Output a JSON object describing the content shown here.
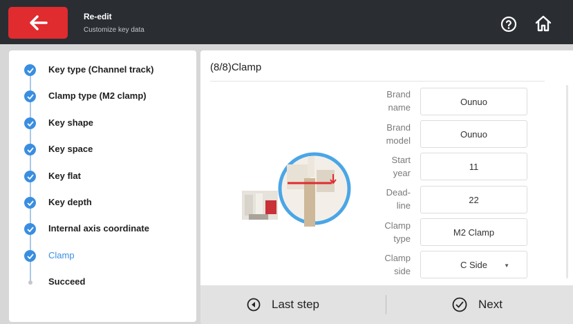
{
  "header": {
    "title": "Re-edit",
    "subtitle": "Customize key data",
    "back_icon": "arrow-left-icon",
    "help_icon": "help-circle-icon",
    "home_icon": "home-icon",
    "back_color": "#e02b2f"
  },
  "steps": [
    {
      "label": "Key type (Channel track)",
      "status": "done"
    },
    {
      "label": "Clamp type (M2 clamp)",
      "status": "done"
    },
    {
      "label": "Key shape",
      "status": "done"
    },
    {
      "label": "Key space",
      "status": "done"
    },
    {
      "label": "Key flat",
      "status": "done"
    },
    {
      "label": "Key depth",
      "status": "done"
    },
    {
      "label": "Internal axis coordinate",
      "status": "done"
    },
    {
      "label": "Clamp",
      "status": "active"
    },
    {
      "label": "Succeed",
      "status": "pending"
    }
  ],
  "main": {
    "title": "(8/8)Clamp",
    "fields": [
      {
        "label_1": "Brand",
        "label_2": "name",
        "value": "Ounuo"
      },
      {
        "label_1": "Brand",
        "label_2": "model",
        "value": "Ounuo"
      },
      {
        "label_1": "Start",
        "label_2": "year",
        "value": "11"
      },
      {
        "label_1": "Dead-",
        "label_2": "line",
        "value": "22"
      },
      {
        "label_1": "Clamp",
        "label_2": "type",
        "value": "M2 Clamp"
      },
      {
        "label_1": "Clamp",
        "label_2": "side",
        "value": "C Side"
      }
    ]
  },
  "footer": {
    "last_label": "Last step",
    "next_label": "Next"
  },
  "colors": {
    "accent": "#3a8ee0",
    "header_bg": "#2a2e33"
  }
}
